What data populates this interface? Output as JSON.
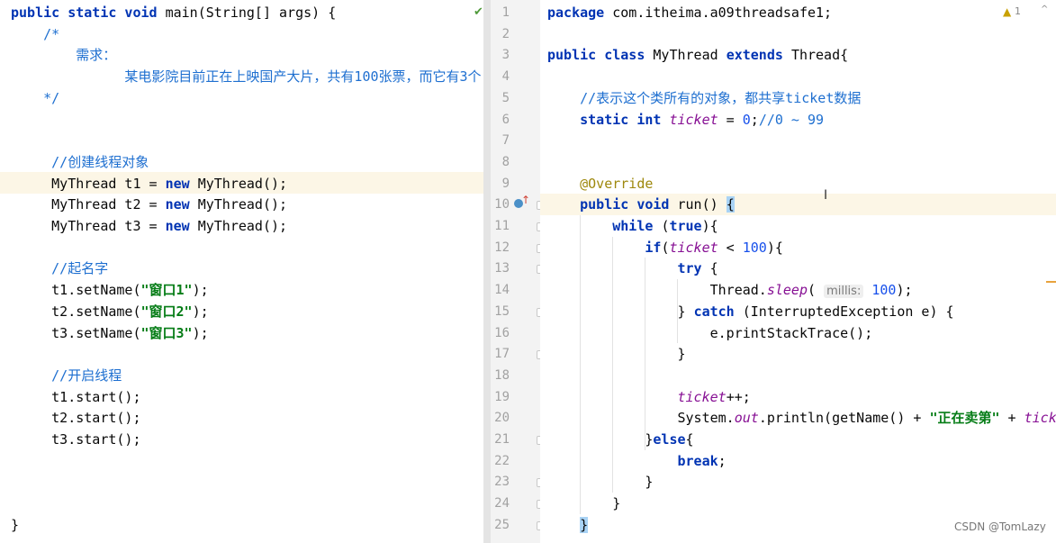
{
  "left_editor": {
    "lines": [
      {
        "parts": [
          [
            "kw",
            "public static void "
          ],
          [
            "",
            "main(String[] args) {"
          ]
        ]
      },
      {
        "parts": [
          [
            "cm",
            "    /*"
          ]
        ]
      },
      {
        "parts": [
          [
            "cm",
            "        需求："
          ]
        ]
      },
      {
        "parts": [
          [
            "cm",
            "              某电影院目前正在上映国产大片，共有100张票，而它有3个"
          ]
        ]
      },
      {
        "parts": [
          [
            "cm",
            "    */"
          ]
        ]
      },
      {
        "parts": []
      },
      {
        "parts": []
      },
      {
        "parts": [
          [
            "cmg",
            "     //创建线程对象"
          ]
        ]
      },
      {
        "parts": [
          [
            "",
            "     MyThread t1 = "
          ],
          [
            "kw",
            "new "
          ],
          [
            "",
            "MyThread();"
          ]
        ]
      },
      {
        "parts": [
          [
            "",
            "     MyThread t2 = "
          ],
          [
            "kw",
            "new "
          ],
          [
            "",
            "MyThread();"
          ]
        ]
      },
      {
        "parts": [
          [
            "",
            "     MyThread t3 = "
          ],
          [
            "kw",
            "new "
          ],
          [
            "",
            "MyThread();"
          ]
        ]
      },
      {
        "parts": []
      },
      {
        "parts": [
          [
            "cmg",
            "     //起名字"
          ]
        ]
      },
      {
        "parts": [
          [
            "",
            "     t1.setName("
          ],
          [
            "str",
            "\"窗口1\""
          ],
          [
            "",
            ");"
          ]
        ]
      },
      {
        "parts": [
          [
            "",
            "     t2.setName("
          ],
          [
            "str",
            "\"窗口2\""
          ],
          [
            "",
            ");"
          ]
        ]
      },
      {
        "parts": [
          [
            "",
            "     t3.setName("
          ],
          [
            "str",
            "\"窗口3\""
          ],
          [
            "",
            ");"
          ]
        ]
      },
      {
        "parts": []
      },
      {
        "parts": [
          [
            "cmg",
            "     //开启线程"
          ]
        ]
      },
      {
        "parts": [
          [
            "",
            "     t1.start();"
          ]
        ]
      },
      {
        "parts": [
          [
            "",
            "     t2.start();"
          ]
        ]
      },
      {
        "parts": [
          [
            "",
            "     t3.start();"
          ]
        ]
      },
      {
        "parts": []
      },
      {
        "parts": []
      },
      {
        "parts": []
      },
      {
        "parts": [
          [
            "",
            "}"
          ]
        ]
      }
    ]
  },
  "right_editor": {
    "line_numbers": [
      "1",
      "2",
      "3",
      "4",
      "5",
      "6",
      "7",
      "8",
      "9",
      "10",
      "11",
      "12",
      "13",
      "14",
      "15",
      "16",
      "17",
      "18",
      "19",
      "20",
      "21",
      "22",
      "23",
      "24",
      "25"
    ],
    "lines": [
      {
        "parts": [
          [
            "kw",
            "package "
          ],
          [
            "",
            "com.itheima.a09threadsafe1;"
          ]
        ]
      },
      {
        "parts": []
      },
      {
        "parts": [
          [
            "kw",
            "public class "
          ],
          [
            "",
            "MyThread "
          ],
          [
            "kw",
            "extends "
          ],
          [
            "",
            "Thread{"
          ]
        ]
      },
      {
        "parts": []
      },
      {
        "parts": [
          [
            "cmg",
            "    //表示这个类所有的对象，都共享ticket数据"
          ]
        ]
      },
      {
        "parts": [
          [
            "kw",
            "    static int "
          ],
          [
            "fld",
            "ticket"
          ],
          [
            "",
            " = "
          ],
          [
            "num",
            "0"
          ],
          [
            "",
            ";"
          ],
          [
            "cm",
            "//0 ~ 99"
          ]
        ]
      },
      {
        "parts": []
      },
      {
        "parts": []
      },
      {
        "parts": [
          [
            "ann",
            "    @Override"
          ]
        ]
      },
      {
        "parts": [
          [
            "kw",
            "    public void "
          ],
          [
            "",
            "run() "
          ],
          [
            "brace",
            "{"
          ]
        ]
      },
      {
        "parts": [
          [
            "kw",
            "        while "
          ],
          [
            "",
            "("
          ],
          [
            "kw",
            "true"
          ],
          [
            "",
            ")"
          ],
          [
            "",
            "{"
          ]
        ]
      },
      {
        "parts": [
          [
            "kw",
            "            if"
          ],
          [
            "",
            "("
          ],
          [
            "fld",
            "ticket"
          ],
          [
            "",
            " < "
          ],
          [
            "num",
            "100"
          ],
          [
            "",
            "){"
          ]
        ]
      },
      {
        "parts": [
          [
            "kw",
            "                try "
          ],
          [
            "",
            "{"
          ]
        ]
      },
      {
        "parts": [
          [
            "",
            "                    Thread."
          ],
          [
            "fld",
            "sleep"
          ],
          [
            "",
            "( "
          ],
          [
            "hint",
            "millis:"
          ],
          [
            "num",
            " 100"
          ],
          [
            "",
            ");"
          ]
        ]
      },
      {
        "parts": [
          [
            "",
            "                } "
          ],
          [
            "kw",
            "catch "
          ],
          [
            "",
            "(InterruptedException e) {"
          ]
        ]
      },
      {
        "parts": [
          [
            "",
            "                    e.printStackTrace();"
          ]
        ]
      },
      {
        "parts": [
          [
            "",
            "                }"
          ]
        ]
      },
      {
        "parts": []
      },
      {
        "parts": [
          [
            "fld",
            "                ticket"
          ],
          [
            "",
            "++;"
          ]
        ]
      },
      {
        "parts": [
          [
            "",
            "                System."
          ],
          [
            "fld",
            "out"
          ],
          [
            "",
            ".println(getName() + "
          ],
          [
            "str",
            "\"正在卖第\""
          ],
          [
            "",
            " + "
          ],
          [
            "fld",
            "ticket"
          ]
        ]
      },
      {
        "parts": [
          [
            "",
            "            }"
          ],
          [
            "kw",
            "else"
          ],
          [
            "",
            "{"
          ]
        ]
      },
      {
        "parts": [
          [
            "kw",
            "                break"
          ],
          [
            "",
            ";"
          ]
        ]
      },
      {
        "parts": [
          [
            "",
            "            }"
          ]
        ]
      },
      {
        "parts": [
          [
            "",
            "        }"
          ]
        ]
      },
      {
        "parts": [
          [
            "",
            "    "
          ],
          [
            "brace",
            "}"
          ]
        ]
      }
    ]
  },
  "status": {
    "warning_count": "1",
    "check_glyph": "✔",
    "warning_glyph": "▲",
    "chevron_glyph": "^"
  },
  "watermark": "CSDN @TomLazy",
  "icons": [
    "check-icon",
    "warning-icon",
    "override-method-icon",
    "text-cursor-icon"
  ]
}
